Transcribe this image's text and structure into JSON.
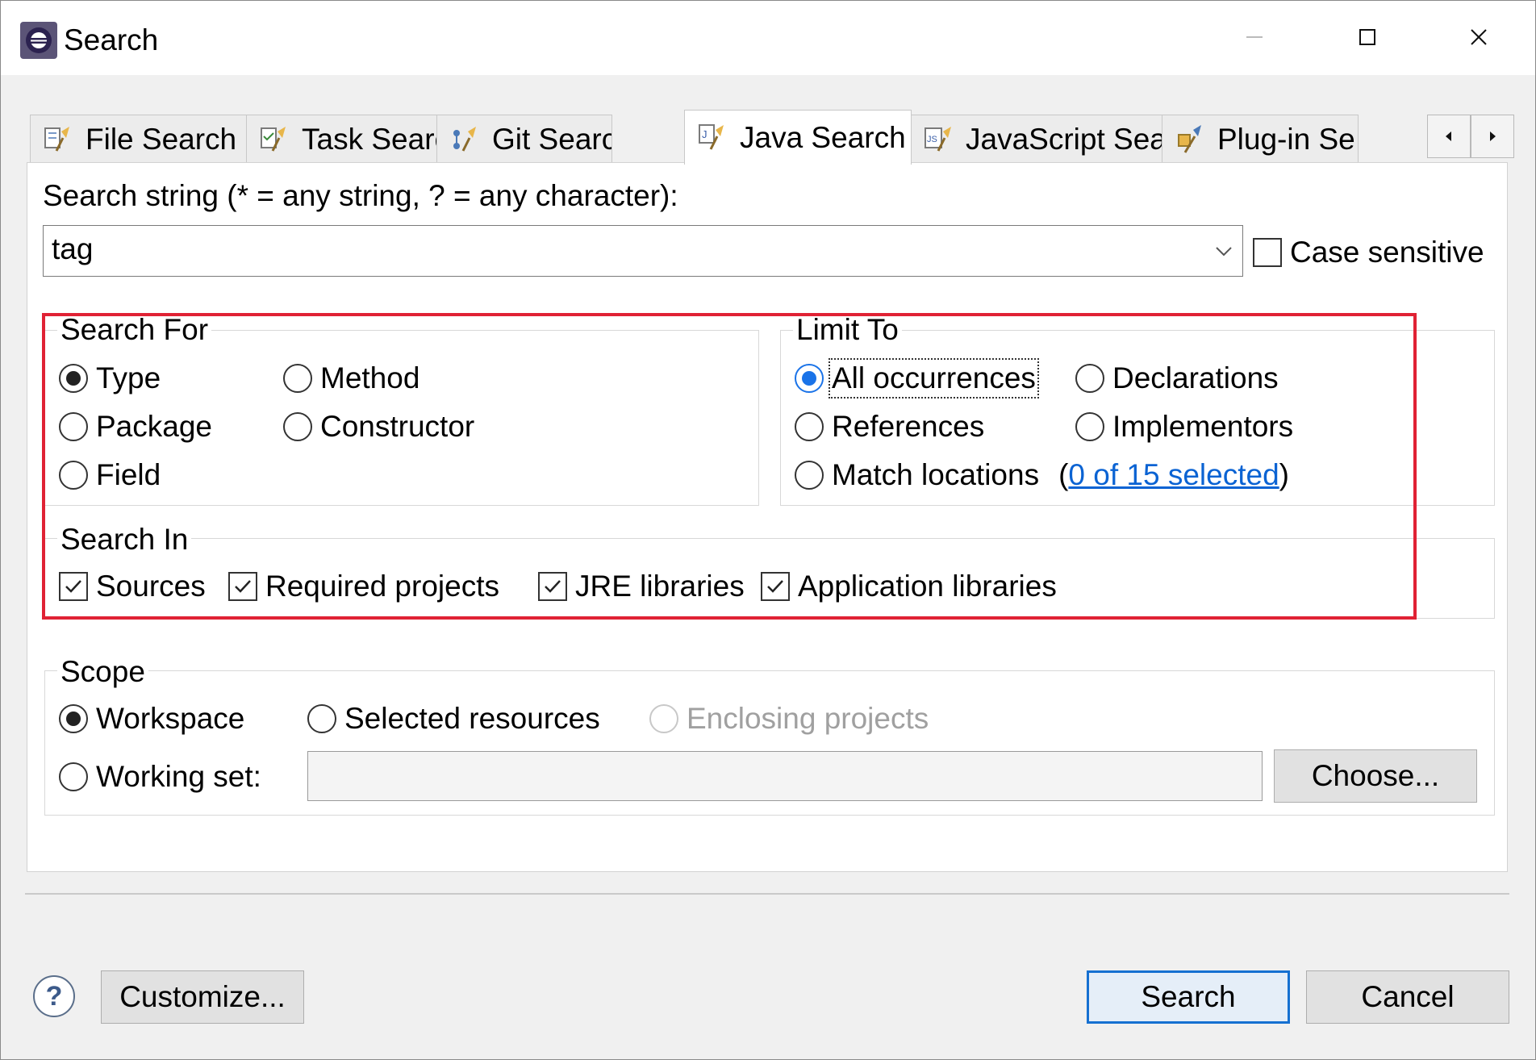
{
  "window": {
    "title": "Search",
    "controls": [
      "minimize-icon",
      "maximize-icon",
      "close-icon"
    ]
  },
  "tabs": [
    {
      "label": "File Search",
      "icon": "file-search-icon",
      "active": false
    },
    {
      "label": "Task Search",
      "icon": "task-search-icon",
      "active": false
    },
    {
      "label": "Git Search",
      "icon": "git-search-icon",
      "active": false
    },
    {
      "label": "Java Search",
      "icon": "java-search-icon",
      "active": true
    },
    {
      "label": "JavaScript Search",
      "icon": "javascript-search-icon",
      "active": false
    },
    {
      "label": "Plug-in Se",
      "icon": "plugin-search-icon",
      "active": false
    }
  ],
  "search_string": {
    "label": "Search string (* = any string, ? = any character):",
    "value": "tag",
    "case_sensitive_label": "Case sensitive",
    "case_sensitive": false
  },
  "search_for": {
    "title": "Search For",
    "options": {
      "type": "Type",
      "method": "Method",
      "package": "Package",
      "constructor": "Constructor",
      "field": "Field"
    },
    "selected": "Type"
  },
  "limit_to": {
    "title": "Limit To",
    "options": {
      "all": "All occurrences",
      "declarations": "Declarations",
      "references": "References",
      "implementors": "Implementors",
      "match": "Match locations"
    },
    "selected": "All occurrences",
    "selection_link": "0 of 15 selected",
    "paren_open": "(",
    "paren_close": ")"
  },
  "search_in": {
    "title": "Search In",
    "sources": "Sources",
    "required": "Required projects",
    "jre": "JRE libraries",
    "app": "Application libraries"
  },
  "scope": {
    "title": "Scope",
    "workspace": "Workspace",
    "selected_resources": "Selected resources",
    "enclosing_projects": "Enclosing projects",
    "working_set": "Working set:",
    "working_set_value": "",
    "choose": "Choose...",
    "selected": "Workspace"
  },
  "footer": {
    "help": "?",
    "customize": "Customize...",
    "search": "Search",
    "cancel": "Cancel"
  },
  "colors": {
    "highlight_box": "#e02234",
    "link": "#0b63d3",
    "focus_button": "#1570d1"
  }
}
